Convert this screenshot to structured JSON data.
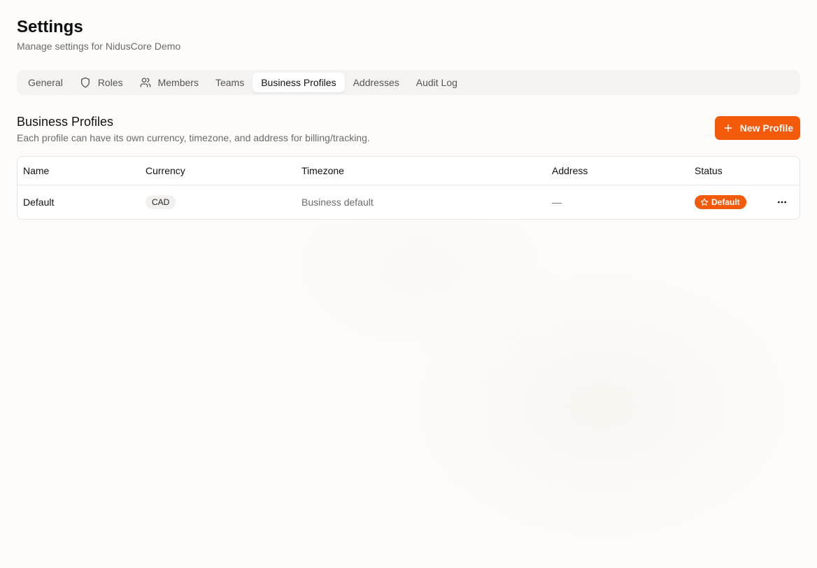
{
  "header": {
    "title": "Settings",
    "subtitle": "Manage settings for NidusCore Demo"
  },
  "tabs": [
    {
      "label": "General",
      "icon": null,
      "active": false
    },
    {
      "label": "Roles",
      "icon": "shield-icon",
      "active": false
    },
    {
      "label": "Members",
      "icon": "users-icon",
      "active": false
    },
    {
      "label": "Teams",
      "icon": null,
      "active": false
    },
    {
      "label": "Business Profiles",
      "icon": null,
      "active": true
    },
    {
      "label": "Addresses",
      "icon": null,
      "active": false
    },
    {
      "label": "Audit Log",
      "icon": null,
      "active": false
    }
  ],
  "section": {
    "title": "Business Profiles",
    "description": "Each profile can have its own currency, timezone, and address for billing/tracking.",
    "new_button_label": "New Profile"
  },
  "table": {
    "columns": [
      "Name",
      "Currency",
      "Timezone",
      "Address",
      "Status"
    ],
    "rows": [
      {
        "name": "Default",
        "currency": "CAD",
        "timezone": "Business default",
        "address": "—",
        "status": "Default"
      }
    ]
  },
  "colors": {
    "accent": "#f35a0a",
    "muted_text": "#6b6b6b",
    "tab_bar_bg": "#f4f3f2"
  }
}
